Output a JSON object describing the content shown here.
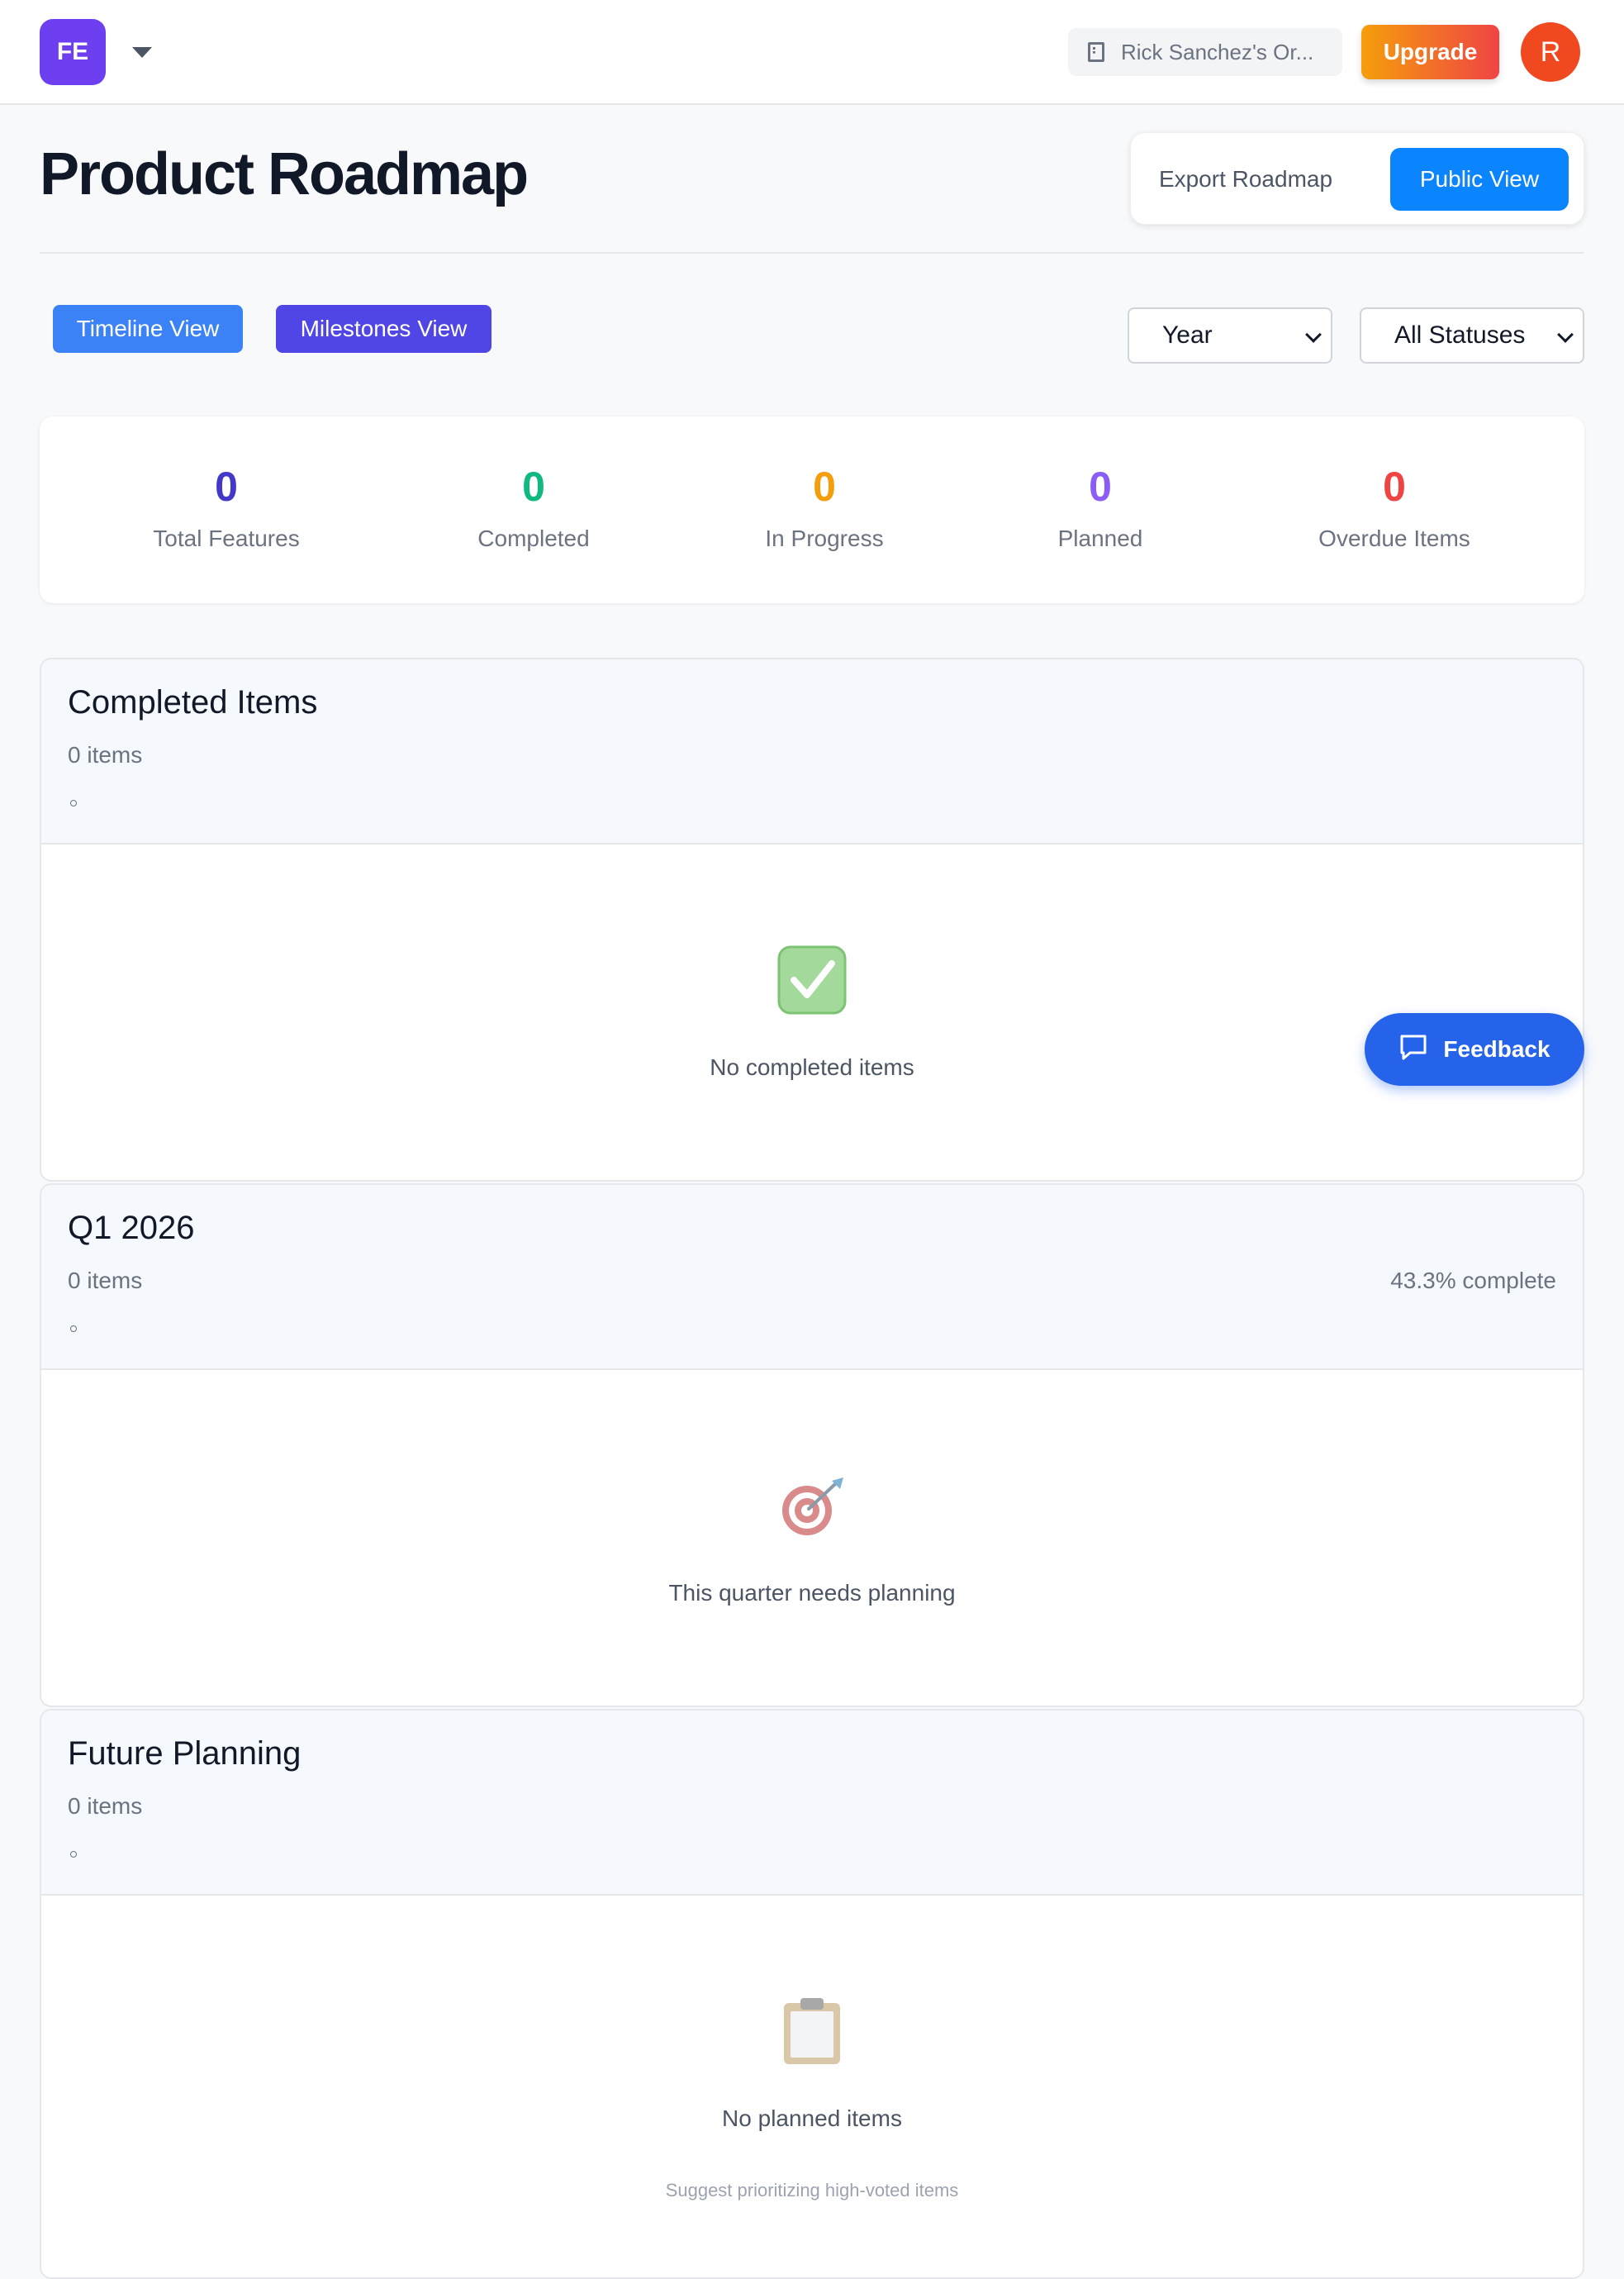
{
  "topbar": {
    "logo_text": "FE",
    "org_name": "Rick Sanchez's Or...",
    "upgrade_label": "Upgrade",
    "avatar_initial": "R"
  },
  "header": {
    "title": "Product Roadmap",
    "export_label": "Export Roadmap",
    "public_view_label": "Public View"
  },
  "views": {
    "timeline_label": "Timeline View",
    "milestones_label": "Milestones View"
  },
  "filters": {
    "period_selected": "Year",
    "status_selected": "All Statuses"
  },
  "stats": [
    {
      "value": "0",
      "label": "Total Features",
      "color": "#4338ca"
    },
    {
      "value": "0",
      "label": "Completed",
      "color": "#10b981"
    },
    {
      "value": "0",
      "label": "In Progress",
      "color": "#f59e0b"
    },
    {
      "value": "0",
      "label": "Planned",
      "color": "#8b5cf6"
    },
    {
      "value": "0",
      "label": "Overdue Items",
      "color": "#ef4444"
    }
  ],
  "sections": {
    "completed": {
      "title": "Completed Items",
      "count": "0 items",
      "empty_icon": "check-box-icon",
      "empty_text": "No completed items"
    },
    "q1": {
      "title": "Q1 2026",
      "count": "0 items",
      "progress": "43.3% complete",
      "empty_icon": "target-dart-icon",
      "empty_text": "This quarter needs planning"
    },
    "future": {
      "title": "Future Planning",
      "count": "0 items",
      "empty_icon": "clipboard-icon",
      "empty_text": "No planned items",
      "empty_subtext": "Suggest prioritizing high-voted items"
    }
  },
  "feedback": {
    "label": "Feedback",
    "icon": "chat-bubble-icon"
  }
}
